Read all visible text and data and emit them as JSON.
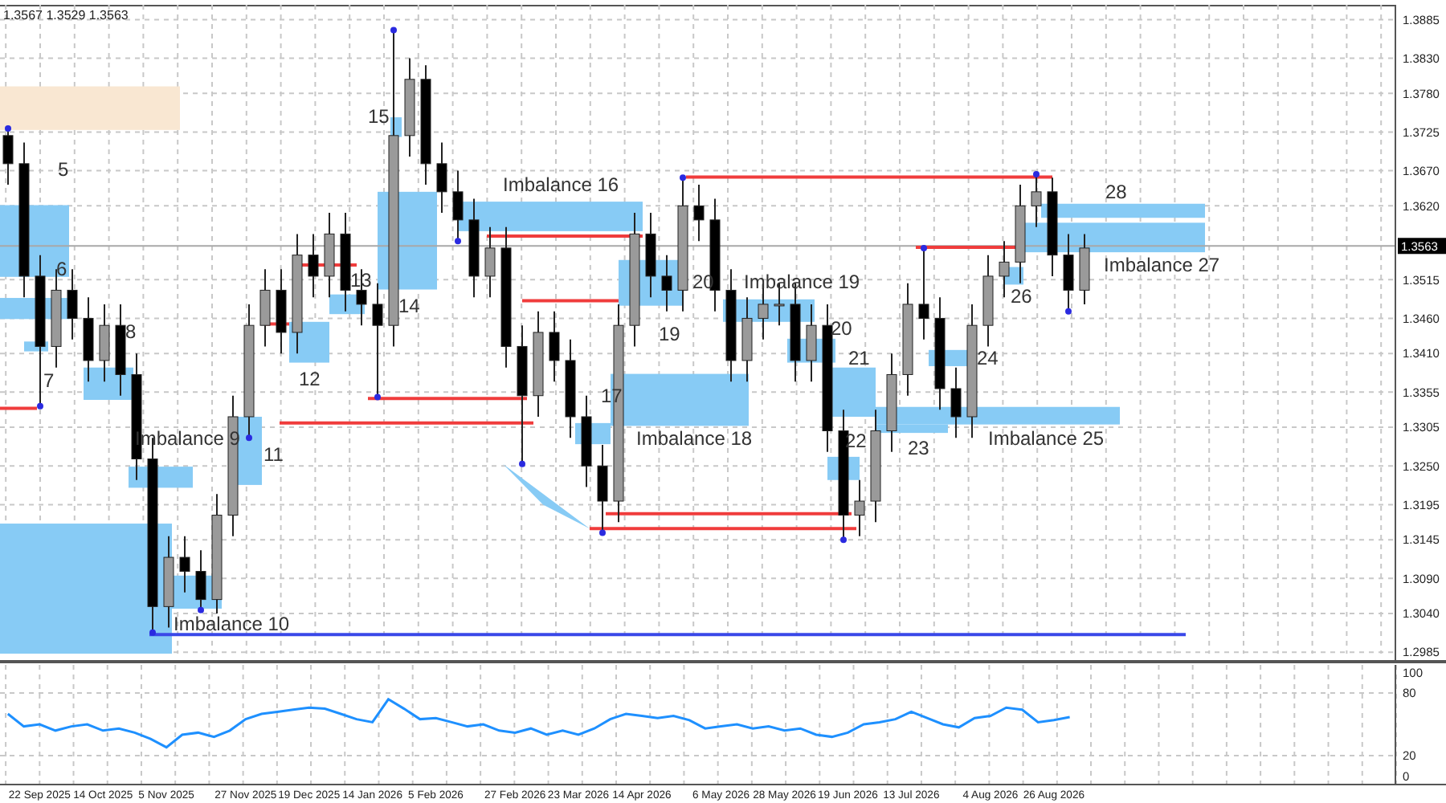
{
  "header": {
    "text": "1.3567 1.3529 1.3563"
  },
  "price_chart": {
    "price_labels": [
      "1.3885",
      "1.3830",
      "1.3780",
      "1.3725",
      "1.3670",
      "1.3620",
      "1.3515",
      "1.3460",
      "1.3410",
      "1.3355",
      "1.3305",
      "1.3250",
      "1.3195",
      "1.3145",
      "1.3090",
      "1.3040",
      "1.2985"
    ],
    "current_price": "1.3563",
    "zone_labels": [
      "5",
      "6",
      "7",
      "8",
      "Imbalance 9",
      "11",
      "Imbalance 10",
      "12",
      "13",
      "14",
      "15",
      "Imbalance 16",
      "17",
      "Imbalance 18",
      "19",
      "20",
      "Imbalance 19",
      "20",
      "21",
      "22",
      "23",
      "24",
      "Imbalance 25",
      "26",
      "Imbalance 27",
      "28"
    ]
  },
  "oscillator": {
    "chart_data": {
      "type": "line",
      "grid": true,
      "categories": [
        null,
        null,
        "22 Sep 2025",
        null,
        null,
        null,
        "14 Oct 2025",
        null,
        null,
        null,
        "5 Nov 2025",
        null,
        null,
        null,
        null,
        "27 Nov 2025",
        null,
        null,
        null,
        "19 Dec 2025",
        null,
        null,
        null,
        "14 Jan 2026",
        null,
        null,
        null,
        "5 Feb 2026",
        null,
        null,
        null,
        null,
        "27 Feb 2026",
        null,
        null,
        null,
        "23 Mar 2026",
        null,
        null,
        null,
        "14 Apr 2026",
        null,
        null,
        null,
        null,
        "6 May 2026",
        null,
        null,
        null,
        "28 May 2026",
        null,
        null,
        null,
        "19 Jun 2026",
        null,
        null,
        null,
        "13 Jul 2026",
        null,
        null,
        null,
        null,
        "4 Aug 2026",
        null,
        null,
        null,
        "26 Aug 2026",
        null,
        null,
        null,
        null,
        null,
        null,
        null,
        null,
        null,
        null,
        null,
        null,
        null,
        null,
        null,
        null,
        null,
        null,
        null,
        null,
        null
      ],
      "ylim": [
        -7,
        107
      ],
      "yticks": [
        0,
        20,
        80,
        100
      ],
      "series": [
        {
          "color": "#1e90ff",
          "values": [
            60,
            48,
            50,
            44,
            48,
            50,
            44,
            46,
            42,
            36,
            28,
            40,
            42,
            38,
            44,
            55,
            60,
            62,
            64,
            66,
            65,
            60,
            55,
            52,
            74,
            65,
            55,
            56,
            52,
            48,
            50,
            44,
            42,
            46,
            40,
            44,
            40,
            46,
            55,
            60,
            58,
            56,
            58,
            54,
            46,
            48,
            50,
            46,
            48,
            44,
            46,
            40,
            38,
            42,
            50,
            52,
            55,
            62,
            56,
            50,
            47,
            56,
            58,
            66,
            64,
            52,
            54,
            57,
            null,
            null,
            null,
            null,
            null,
            null,
            null,
            null,
            null,
            null,
            null,
            null,
            null,
            null,
            null,
            null,
            null,
            null,
            null,
            null
          ]
        }
      ]
    }
  }
}
